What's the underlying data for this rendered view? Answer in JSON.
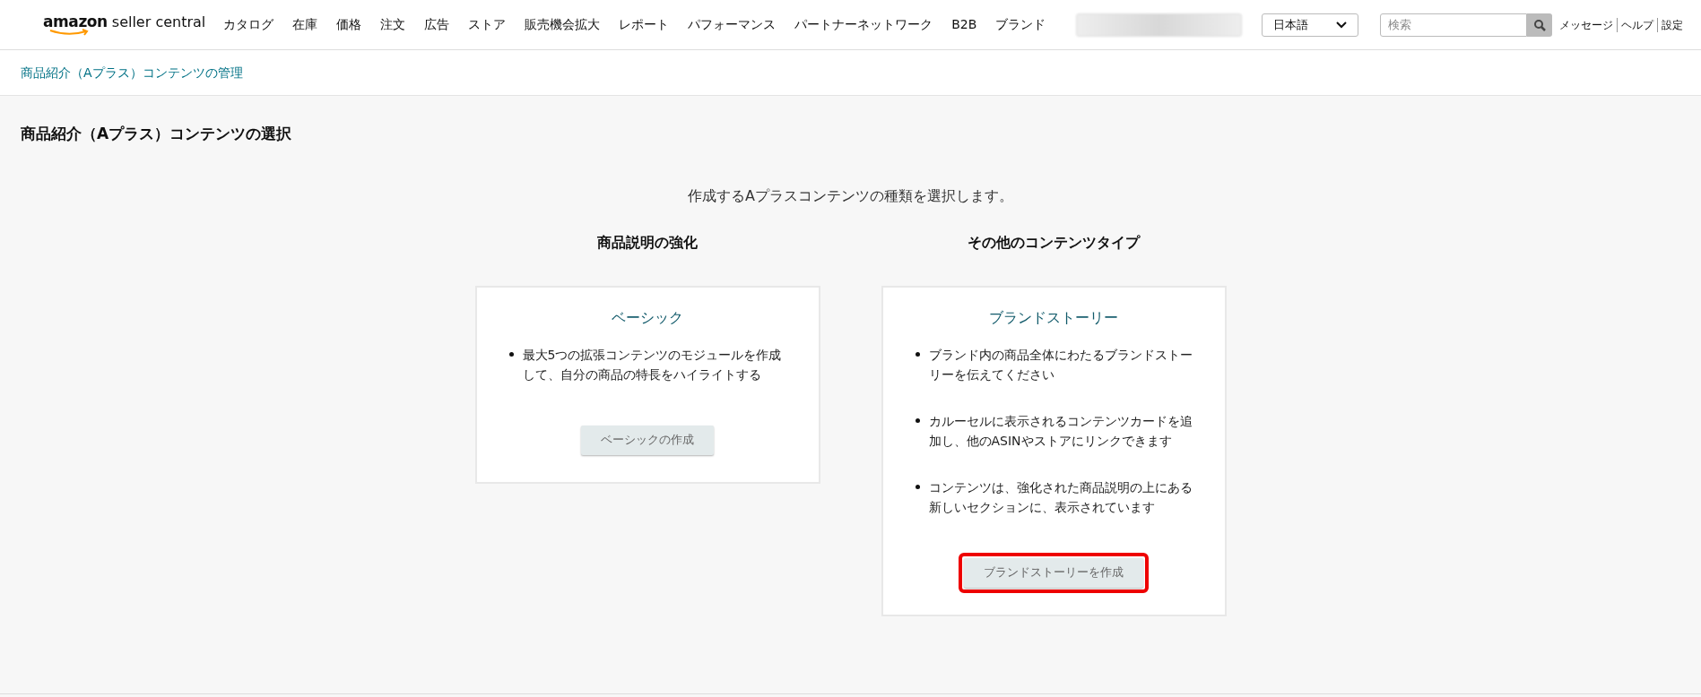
{
  "header": {
    "logo": {
      "brand": "amazon",
      "product": "seller central"
    },
    "nav": [
      "カタログ",
      "在庫",
      "価格",
      "注文",
      "広告",
      "ストア",
      "販売機会拡大",
      "レポート",
      "パフォーマンス",
      "パートナーネットワーク",
      "B2B",
      "ブランド"
    ],
    "language": "日本語",
    "search": {
      "placeholder": "検索"
    },
    "links": [
      "メッセージ",
      "ヘルプ",
      "設定"
    ]
  },
  "breadcrumb": "商品紹介（Aプラス）コンテンツの管理",
  "page_title": "商品紹介（Aプラス）コンテンツの選択",
  "intro": "作成するAプラスコンテンツの種類を選択します。",
  "columns": [
    {
      "heading": "商品説明の強化",
      "card": {
        "title": "ベーシック",
        "bullets": [
          "最大5つの拡張コンテンツのモジュールを作成して、自分の商品の特長をハイライトする"
        ],
        "button": {
          "label": "ベーシックの作成",
          "highlighted": false
        }
      }
    },
    {
      "heading": "その他のコンテンツタイプ",
      "card": {
        "title": "ブランドストーリー",
        "bullets": [
          "ブランド内の商品全体にわたるブランドストーリーを伝えてください",
          "カルーセルに表示されるコンテンツカードを追加し、他のASINやストアにリンクできます",
          "コンテンツは、強化された商品説明の上にある新しいセクションに、表示されています"
        ],
        "button": {
          "label": "ブランドストーリーを作成",
          "highlighted": true
        }
      }
    }
  ]
}
